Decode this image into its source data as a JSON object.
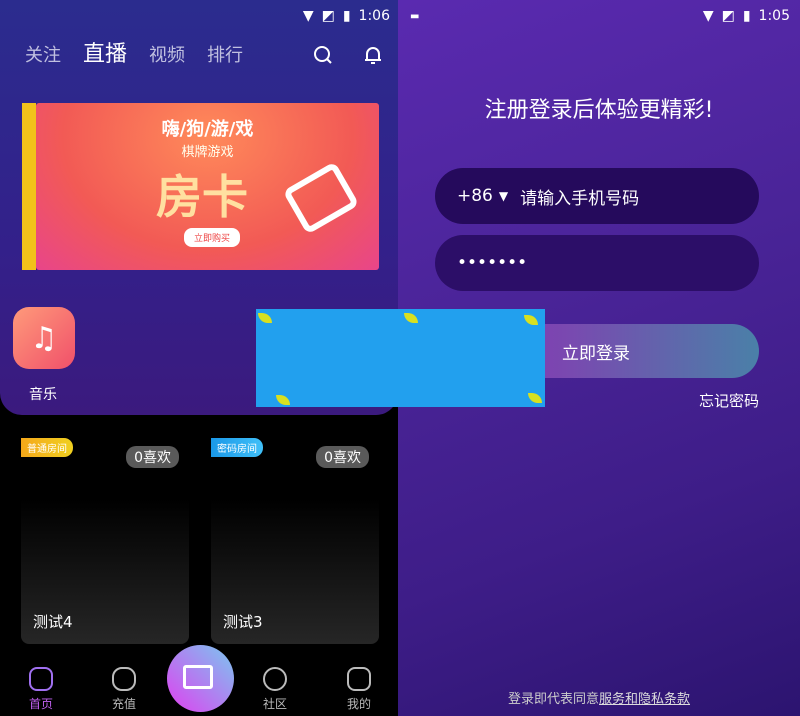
{
  "left": {
    "status": {
      "time": "1:06"
    },
    "tabs": [
      {
        "label": "关注"
      },
      {
        "label": "直播",
        "active": true
      },
      {
        "label": "视频"
      },
      {
        "label": "排行"
      }
    ],
    "banner": {
      "title": "嗨/狗/游/戏",
      "subtitle": "棋牌游戏",
      "headline": "房卡",
      "button": "立即购买"
    },
    "apps": [
      {
        "label": "音乐",
        "icon": "music-note-icon"
      }
    ],
    "rooms": [
      {
        "badge": "普通房间",
        "badge_color": "#f5b21a",
        "likes": "0喜欢",
        "title": "测试4"
      },
      {
        "badge": "密码房间",
        "badge_color": "#1aa8f0",
        "likes": "0喜欢",
        "title": "测试3"
      }
    ],
    "nav": [
      {
        "label": "首页",
        "icon": "home-icon",
        "active": true
      },
      {
        "label": "充值",
        "icon": "money-bag-icon"
      },
      {
        "label": "社区",
        "icon": "chat-smile-icon"
      },
      {
        "label": "我的",
        "icon": "user-icon"
      }
    ]
  },
  "right": {
    "status": {
      "time": "1:05"
    },
    "title": "注册登录后体验更精彩!",
    "country_code": "+86",
    "phone_placeholder": "请输入手机号码",
    "password_value": "•••••••",
    "login_button": "立即登录",
    "forgot": "忘记密码",
    "terms_prefix": "登录即代表同意",
    "terms_link": "服务和隐私条款"
  },
  "colors": {
    "accent": "#c060f0",
    "header": "#2b2c8e",
    "right_bg": "#4a2498"
  }
}
